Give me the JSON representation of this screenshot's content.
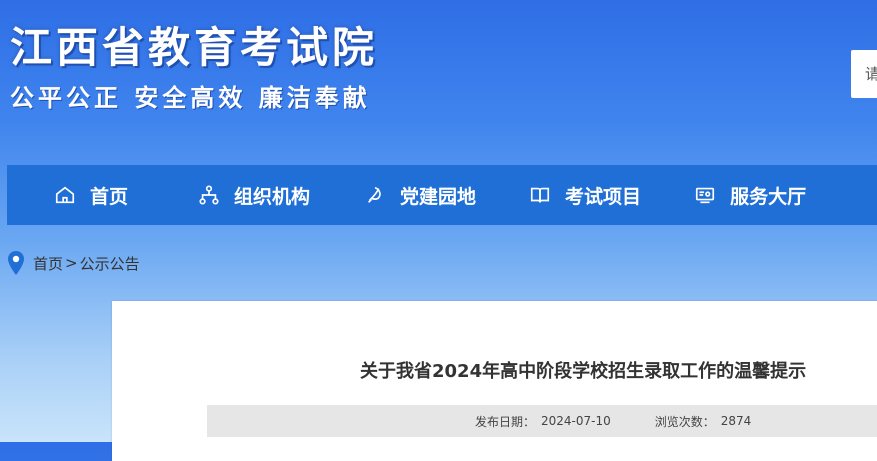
{
  "header": {
    "title": "江西省教育考试院",
    "slogan": "公平公正  安全高效  廉洁奉献",
    "search_placeholder": "请输入关键字"
  },
  "nav": {
    "items": [
      {
        "label": "首页",
        "icon": "home-icon"
      },
      {
        "label": "组织机构",
        "icon": "org-chart-icon"
      },
      {
        "label": "党建园地",
        "icon": "party-emblem-icon"
      },
      {
        "label": "考试项目",
        "icon": "book-icon"
      },
      {
        "label": "服务大厅",
        "icon": "service-icon"
      }
    ]
  },
  "breadcrumb": {
    "home": "首页",
    "separator": ">",
    "current": "公示公告"
  },
  "article": {
    "title": "关于我省2024年高中阶段学校招生录取工作的温馨提示",
    "date_label": "发布日期：",
    "date": "2024-07-10",
    "views_label": "浏览次数：",
    "views": "2874"
  },
  "colors": {
    "nav_bg": "#1f6fd6",
    "pin": "#1f6fd6"
  }
}
